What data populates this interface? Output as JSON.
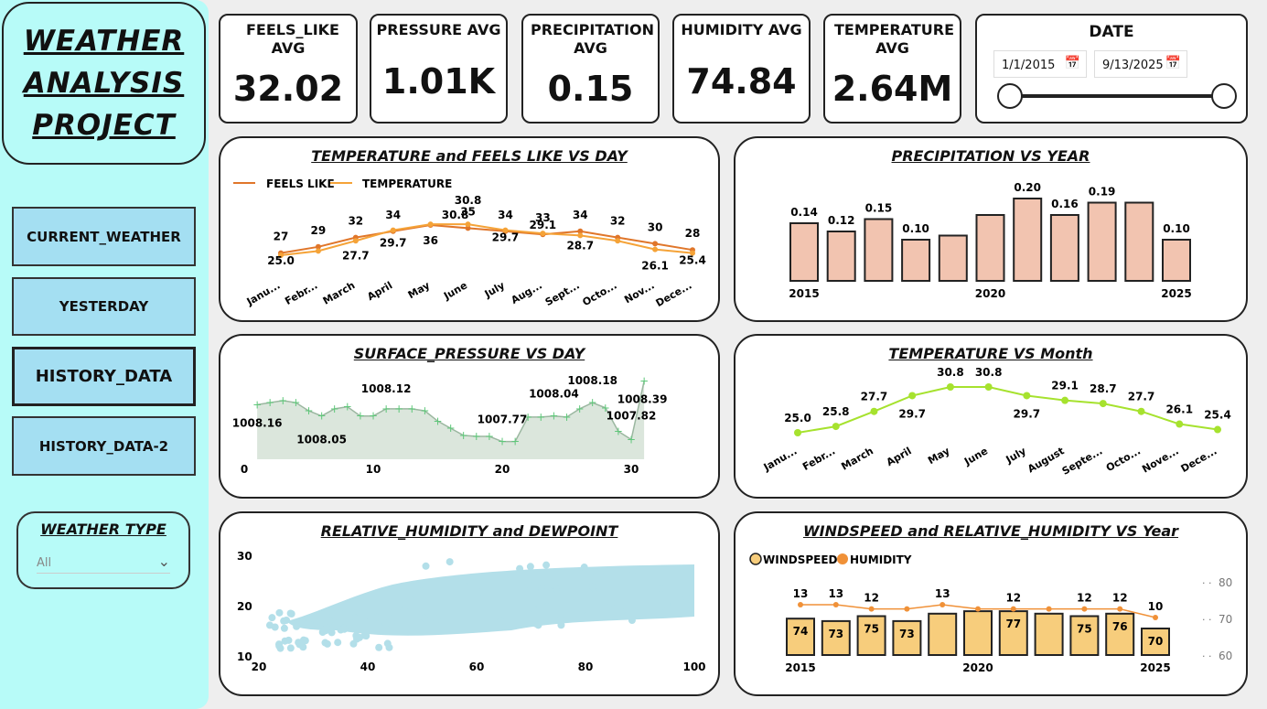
{
  "sidebar": {
    "title_lines": [
      "WEATHER ",
      "ANALYSIS ",
      "PROJECT"
    ],
    "nav": [
      {
        "label": "CURRENT_WEATHER"
      },
      {
        "label": "YESTERDAY"
      },
      {
        "label": "HISTORY_DATA",
        "active": true
      },
      {
        "label": "HISTORY_DATA-2"
      }
    ],
    "filter_label": "WEATHER TYPE",
    "filter_value": "All"
  },
  "kpis": [
    {
      "title": "FEELS_LIKE AVG",
      "value": "32.02"
    },
    {
      "title": "PRESSURE AVG",
      "value": "1.01K"
    },
    {
      "title": "PRECIPITATION AVG",
      "value": "0.15"
    },
    {
      "title": "HUMIDITY AVG",
      "value": "74.84"
    },
    {
      "title": "TEMPERATURE AVG",
      "value": "2.64M"
    }
  ],
  "date_filter": {
    "label": "DATE",
    "start": "1/1/2015",
    "end": "9/13/2025",
    "icon": "calendar-icon"
  },
  "colors": {
    "sidebar": "#b7fbf8",
    "nav": "#a4dff2",
    "feels": "#e0762a",
    "temp": "#f5a338",
    "precip": "#f2c4b0",
    "pressure": "#5fc87a",
    "month": "#a6e22e",
    "scatter": "#b3dfe9",
    "bars": "#f7cd7c",
    "humidity": "#f09138"
  },
  "chart_data": [
    {
      "type": "line",
      "title": "TEMPERATURE and FEELS LIKE VS DAY",
      "categories": [
        "Janu...",
        "Febr...",
        "March",
        "April",
        "May",
        "June",
        "July",
        "Aug...",
        "Sept...",
        "Octo...",
        "Nov...",
        "Dece..."
      ],
      "legend_position": "top-left",
      "series": [
        {
          "name": "FEELS LIKE",
          "values": [
            27,
            29,
            32,
            34,
            36,
            35,
            34,
            33,
            34,
            32,
            30,
            28
          ],
          "labels": [
            "27",
            "29",
            "32",
            "34",
            "36",
            "35",
            "34",
            "33",
            "34",
            "32",
            "30",
            "28"
          ]
        },
        {
          "name": "TEMPERATURE",
          "values": [
            25.0,
            25.8,
            27.7,
            29.7,
            30.8,
            30.8,
            29.7,
            29.1,
            28.7,
            27.7,
            26.1,
            25.4
          ],
          "labels": [
            "25.0",
            "",
            "27.7",
            "29.7",
            "",
            "30.8",
            "29.7",
            "29.1",
            "28.7",
            "",
            "26.1",
            "25.4"
          ],
          "extra_label": "30.8"
        }
      ]
    },
    {
      "type": "bar",
      "title": "PRECIPITATION VS YEAR",
      "categories": [
        "2015",
        "2016",
        "2017",
        "2018",
        "2019",
        "2020",
        "2021",
        "2022",
        "2023",
        "2024",
        "2025"
      ],
      "tick_labels": [
        "2015",
        "",
        "",
        "",
        "",
        "2020",
        "",
        "",
        "",
        "",
        "2025"
      ],
      "values": [
        0.14,
        0.12,
        0.15,
        0.1,
        0.11,
        0.16,
        0.2,
        0.16,
        0.19,
        0.19,
        0.1
      ],
      "value_labels": [
        "0.14",
        "0.12",
        "0.15",
        "0.10",
        "",
        "",
        "0.20",
        "0.16",
        "0.19",
        "",
        "0.10"
      ]
    },
    {
      "type": "area",
      "title": "SURFACE_PRESSURE VS DAY",
      "x": [
        1,
        2,
        3,
        4,
        5,
        6,
        7,
        8,
        9,
        10,
        11,
        12,
        13,
        14,
        15,
        16,
        17,
        18,
        19,
        20,
        21,
        22,
        23,
        24,
        25,
        26,
        27,
        28,
        29,
        30,
        31
      ],
      "values": [
        1008.16,
        1008.18,
        1008.2,
        1008.18,
        1008.1,
        1008.05,
        1008.12,
        1008.14,
        1008.05,
        1008.05,
        1008.12,
        1008.12,
        1008.12,
        1008.1,
        1008.0,
        1007.93,
        1007.86,
        1007.85,
        1007.85,
        1007.8,
        1007.8,
        1008.04,
        1008.04,
        1008.05,
        1008.04,
        1008.12,
        1008.18,
        1008.13,
        1007.9,
        1007.82,
        1008.39
      ],
      "data_labels": [
        {
          "x": 1,
          "text": "1008.16"
        },
        {
          "x": 6,
          "text": "1008.05"
        },
        {
          "x": 11,
          "text": "1008.12"
        },
        {
          "x": 20,
          "text": "1007.77"
        },
        {
          "x": 24,
          "text": "1008.04"
        },
        {
          "x": 27,
          "text": "1008.18"
        },
        {
          "x": 30,
          "text": "1007.82"
        },
        {
          "x": 31,
          "text": "1008.39"
        }
      ],
      "x_ticks": [
        "0",
        "10",
        "20",
        "30"
      ]
    },
    {
      "type": "line",
      "title": "TEMPERATURE VS Month",
      "categories": [
        "Janu...",
        "Febr...",
        "March",
        "April",
        "May",
        "June",
        "July",
        "August",
        "Septe...",
        "Octo...",
        "Nove...",
        "Dece..."
      ],
      "values": [
        25.0,
        25.8,
        27.7,
        29.7,
        30.8,
        30.8,
        29.7,
        29.1,
        28.7,
        27.7,
        26.1,
        25.4
      ],
      "value_labels": [
        "25.0",
        "25.8",
        "27.7",
        "29.7",
        "30.8",
        "30.8",
        "29.7",
        "29.1",
        "28.7",
        "27.7",
        "26.1",
        "25.4"
      ]
    },
    {
      "type": "scatter",
      "title": "RELATIVE_HUMIDITY and DEWPOINT",
      "x_ticks": [
        "20",
        "40",
        "60",
        "80",
        "100"
      ],
      "y_ticks": [
        "30",
        "20",
        "10"
      ],
      "xlim": [
        20,
        100
      ],
      "ylim": [
        10,
        30
      ]
    },
    {
      "type": "bar",
      "title": "WINDSPEED and RELATIVE_HUMIDITY VS Year",
      "legend_position": "top-left",
      "categories": [
        "2015",
        "2016",
        "2017",
        "2018",
        "2019",
        "2020",
        "2021",
        "2022",
        "2023",
        "2024",
        "2025"
      ],
      "tick_labels": [
        "2015",
        "",
        "",
        "",
        "",
        "2020",
        "",
        "",
        "",
        "",
        "2025"
      ],
      "series": [
        {
          "name": "WINDSPEED",
          "values": [
            13,
            13,
            12,
            12,
            13,
            12,
            12,
            12,
            12,
            12,
            10
          ],
          "labels": [
            "13",
            "13",
            "12",
            "",
            "13",
            "",
            "12",
            "",
            "12",
            "12",
            "10"
          ]
        },
        {
          "name": "HUMIDITY",
          "values": [
            74,
            73,
            75,
            73,
            76,
            77,
            77,
            76,
            75,
            76,
            70
          ],
          "labels": [
            "74",
            "73",
            "75",
            "73",
            "",
            "",
            "77",
            "",
            "75",
            "76",
            "70"
          ]
        }
      ],
      "y_ticks_right": [
        "80",
        "70",
        "60"
      ]
    }
  ]
}
